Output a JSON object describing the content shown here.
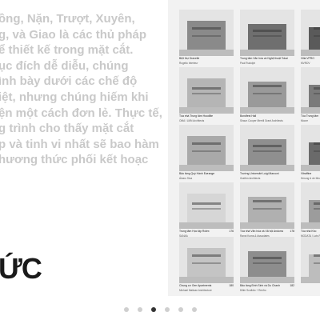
{
  "slide": {
    "body_lines": [
      "ồng, Nặn, Trượt, Xuyên,",
      "g, và Giao là các thủ pháp",
      "ể thiết kế trong mặt cắt.",
      "ục đích dễ diễu, chúng",
      "ình bày dưới các chế độ",
      "iệt, nhưng chúng hiếm khi",
      "ện một cách đơn lẻ. Thực tế,",
      "g trình cho thấy mặt cắt",
      "p và tinh vi nhất sẽ bao hàm",
      "hương thức phối kết hoạc"
    ],
    "heading": "ỨC"
  },
  "tiles": [
    {
      "title": "Biệt thự Dravelle",
      "architect": "Rogelio Interieur",
      "number": "",
      "tone": "#8a8a8a"
    },
    {
      "title": "Trung tâm Văn hóa và Nghệ thuật Tokai",
      "architect": "Paul Rudolph",
      "number": "",
      "tone": "#6f6f6f"
    },
    {
      "title": "Villa VPRO",
      "architect": "MVRDV",
      "number": "",
      "tone": "#5a5a5a"
    },
    {
      "title": "Tòa nhà Trung tâm Hoodlite",
      "architect": "OMA / LMN Architects",
      "number": "",
      "tone": "#b5b5b5"
    },
    {
      "title": "Bondfest Hall",
      "architect": "Shaun Cooper Merrill Grant Architects",
      "number": "",
      "tone": "#9a9a9a"
    },
    {
      "title": "Tòa Trung tâm",
      "architect": "Moore",
      "number": "",
      "tone": "#7a7a7a"
    },
    {
      "title": "Bảo tàng Quý Hành Ewrange",
      "architect": "Álvaro Siza",
      "number": "",
      "tone": "#a9a9a9"
    },
    {
      "title": "Trường Université Luigi Marconi",
      "architect": "Graftón Architects",
      "number": "",
      "tone": "#8f8f8f"
    },
    {
      "title": "Vitraffine",
      "architect": "Herzog & de Meuron",
      "number": "",
      "tone": "#6a6a6a"
    },
    {
      "title": "Trung tâm Học tập Rolex",
      "architect": "SANAA",
      "number": "176",
      "tone": "#d6d6d6"
    },
    {
      "title": "Tòa nhà Văn hóa và Xã hội Andorra",
      "architect": "Rangi Kuma & Associates",
      "number": "178",
      "tone": "#b0b0b0"
    },
    {
      "title": "Tòa nhà Kho",
      "architect": "MODATA / Lots R.",
      "number": "",
      "tone": "#9c9c9c"
    },
    {
      "title": "Chung cư Gen Apartments",
      "architect": "Michael Maltzan Architecture",
      "number": "180",
      "tone": "#c4c4c4"
    },
    {
      "title": "Bảo tàng Đinh Sinh và Du Chanh",
      "architect": "Diller Scofidio + Renfro",
      "number": "182",
      "tone": "#8d8d8d"
    },
    {
      "title": "",
      "architect": "",
      "number": "",
      "tone": "#bdbdbd"
    }
  ],
  "pager": {
    "count": 6,
    "active_index": 2
  },
  "colors": {
    "background": "#ffffff",
    "panel": "#f2f2f2",
    "body_text": "#c9c9c9",
    "heading": "#1a1a1a",
    "dot": "#cfcfcf",
    "dot_active": "#333333"
  }
}
